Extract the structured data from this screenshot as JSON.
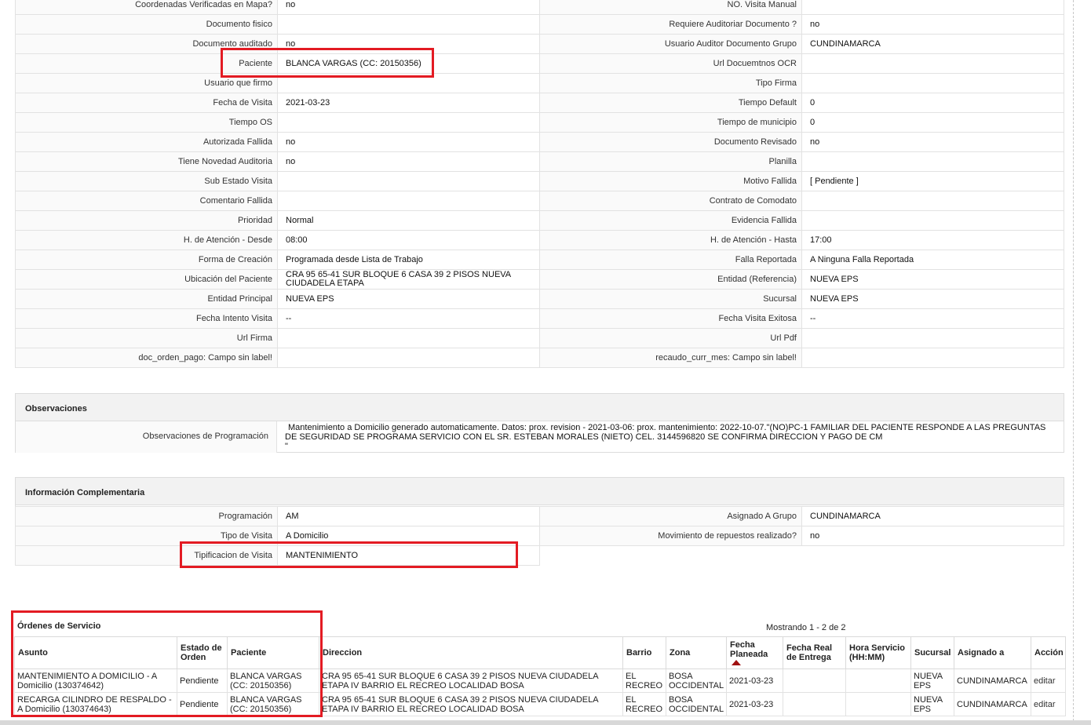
{
  "details": {
    "rows": [
      {
        "l1": "Coordenadas Verificadas en Mapa?",
        "v1": "no",
        "l2": "NO. Visita Manual",
        "v2": ""
      },
      {
        "l1": "Documento fisico",
        "v1": "",
        "l2": "Requiere Auditoriar Documento ?",
        "v2": "no"
      },
      {
        "l1": "Documento auditado",
        "v1": "no",
        "l2": "Usuario Auditor Documento Grupo",
        "v2": "CUNDINAMARCA"
      },
      {
        "l1": "Paciente",
        "v1": "BLANCA VARGAS (CC: 20150356)",
        "l2": "Url Docuemtnos OCR",
        "v2": ""
      },
      {
        "l1": "Usuario que firmo",
        "v1": "",
        "l2": "Tipo Firma",
        "v2": ""
      },
      {
        "l1": "Fecha de Visita",
        "v1": "2021-03-23",
        "l2": "Tiempo Default",
        "v2": "0"
      },
      {
        "l1": "Tiempo OS",
        "v1": "",
        "l2": "Tiempo de municipio",
        "v2": "0"
      },
      {
        "l1": "Autorizada Fallida",
        "v1": "no",
        "l2": "Documento Revisado",
        "v2": "no"
      },
      {
        "l1": "Tiene Novedad Auditoria",
        "v1": "no",
        "l2": "Planilla",
        "v2": ""
      },
      {
        "l1": "Sub Estado Visita",
        "v1": "",
        "l2": "Motivo Fallida",
        "v2": "[ Pendiente ]"
      },
      {
        "l1": "Comentario Fallida",
        "v1": "",
        "l2": "Contrato de Comodato",
        "v2": ""
      },
      {
        "l1": "Prioridad",
        "v1": "Normal",
        "l2": "Evidencia Fallida",
        "v2": ""
      },
      {
        "l1": "H. de Atención - Desde",
        "v1": "08:00",
        "l2": "H. de Atención - Hasta",
        "v2": "17:00"
      },
      {
        "l1": "Forma de Creación",
        "v1": "Programada desde Lista de Trabajo",
        "l2": "Falla Reportada",
        "v2": "A Ninguna Falla Reportada"
      },
      {
        "l1": "Ubicación del Paciente",
        "v1": "CRA 95 65-41 SUR BLOQUE 6 CASA 39 2 PISOS NUEVA CIUDADELA ETAPA",
        "l2": "Entidad (Referencia)",
        "v2": "NUEVA EPS"
      },
      {
        "l1": "Entidad Principal",
        "v1": "NUEVA EPS",
        "l2": "Sucursal",
        "v2": "NUEVA EPS"
      },
      {
        "l1": "Fecha Intento Visita",
        "v1": "--",
        "l2": "Fecha Visita Exitosa",
        "v2": "--"
      },
      {
        "l1": "Url Firma",
        "v1": "",
        "l2": "Url Pdf",
        "v2": ""
      },
      {
        "l1": "doc_orden_pago: Campo sin label!",
        "v1": "",
        "l2": "recaudo_curr_mes: Campo sin label!",
        "v2": ""
      }
    ]
  },
  "observaciones": {
    "title": "Observaciones",
    "label": "Observaciones de Programación",
    "text": "Mantenimiento a Domicilio generado automaticamente. Datos: prox. revision - 2021-03-06: prox. mantenimiento: 2022-10-07.\"(NO)PC-1 FAMILIAR DEL PACIENTE RESPONDE A LAS PREGUNTAS DE SEGURIDAD SE PROGRAMA SERVICIO CON EL SR. ESTEBAN MORALES (NIETO) CEL. 3144596820 SE CONFIRMA DIRECCION Y PAGO DE CM",
    "trail": "\""
  },
  "complementaria": {
    "title": "Información Complementaria",
    "rows": [
      {
        "l1": "Programación",
        "v1": "AM",
        "l2": "Asignado A Grupo",
        "v2": "CUNDINAMARCA"
      },
      {
        "l1": "Tipo de Visita",
        "v1": "A Domicilio",
        "l2": "Movimiento de repuestos realizado?",
        "v2": "no"
      }
    ],
    "last": {
      "l1": "Tipificacion de Visita",
      "v1": "MANTENIMIENTO"
    }
  },
  "ordenes": {
    "title": "Órdenes de Servicio",
    "mostrando": "Mostrando 1 - 2 de 2",
    "headers": [
      "Asunto",
      "Estado de Orden",
      "Paciente",
      "Direccion",
      "Barrio",
      "Zona",
      "Fecha Planeada",
      "Fecha Real de Entrega",
      "Hora Servicio (HH:MM)",
      "Sucursal",
      "Asignado a",
      "Acción"
    ],
    "rows": [
      {
        "asunto": "MANTENIMIENTO A DOMICILIO - A Domicilio (130374642)",
        "estado": "Pendiente",
        "paciente": "BLANCA VARGAS (CC: 20150356)",
        "direccion": "CRA 95 65-41 SUR BLOQUE 6 CASA 39 2 PISOS NUEVA CIUDADELA ETAPA IV BARRIO EL RECREO LOCALIDAD BOSA",
        "barrio": "EL RECREO",
        "zona": "BOSA OCCIDENTAL",
        "fecha": "2021-03-23",
        "fecha_real": "",
        "hora": "",
        "sucursal": "NUEVA EPS",
        "asignado": "CUNDINAMARCA",
        "accion": "editar"
      },
      {
        "asunto": "RECARGA CILINDRO DE RESPALDO - A Domicilio (130374643)",
        "estado": "Pendiente",
        "paciente": "BLANCA VARGAS (CC: 20150356)",
        "direccion": "CRA 95 65-41 SUR BLOQUE 6 CASA 39 2 PISOS NUEVA CIUDADELA ETAPA IV BARRIO EL RECREO LOCALIDAD BOSA",
        "barrio": "EL RECREO",
        "zona": "BOSA OCCIDENTAL",
        "fecha": "2021-03-23",
        "fecha_real": "",
        "hora": "",
        "sucursal": "NUEVA EPS",
        "asignado": "CUNDINAMARCA",
        "accion": "editar"
      }
    ]
  }
}
